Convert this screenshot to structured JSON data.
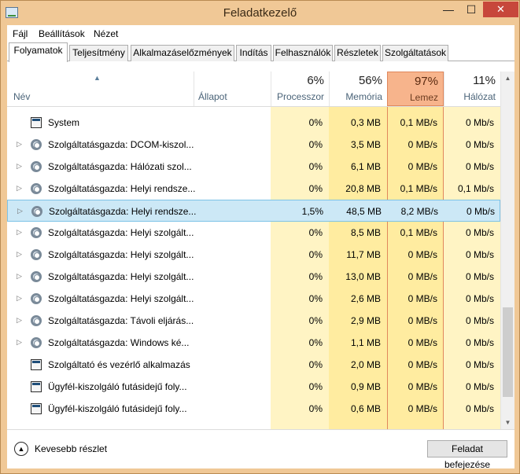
{
  "window": {
    "title": "Feladatkezelő",
    "min_glyph": "—",
    "max_glyph": "☐",
    "close_glyph": "✕"
  },
  "menu": [
    "Fájl",
    "Beállítások",
    "Nézet"
  ],
  "tabs": [
    "Folyamatok",
    "Teljesítmény",
    "Alkalmazáselőzmények",
    "Indítás",
    "Felhasználók",
    "Részletek",
    "Szolgáltatások"
  ],
  "active_tab": "Folyamatok",
  "columns": {
    "name": "Név",
    "status": "Állapot",
    "cpu": {
      "pct": "6%",
      "label": "Processzor"
    },
    "memory": {
      "pct": "56%",
      "label": "Memória"
    },
    "disk": {
      "pct": "97%",
      "label": "Lemez"
    },
    "network": {
      "pct": "11%",
      "label": "Hálózat"
    }
  },
  "rows": [
    {
      "icon": "window-icon",
      "expandable": false,
      "name": "System",
      "cpu": "0%",
      "mem": "0,3 MB",
      "disk": "0,1 MB/s",
      "net": "0 Mb/s"
    },
    {
      "icon": "gear-icon",
      "expandable": true,
      "name": "Szolgáltatásgazda: DCOM-kiszol...",
      "cpu": "0%",
      "mem": "3,5 MB",
      "disk": "0 MB/s",
      "net": "0 Mb/s"
    },
    {
      "icon": "gear-icon",
      "expandable": true,
      "name": "Szolgáltatásgazda: Hálózati szol...",
      "cpu": "0%",
      "mem": "6,1 MB",
      "disk": "0 MB/s",
      "net": "0 Mb/s"
    },
    {
      "icon": "gear-icon",
      "expandable": true,
      "name": "Szolgáltatásgazda: Helyi rendsze...",
      "cpu": "0%",
      "mem": "20,8 MB",
      "disk": "0,1 MB/s",
      "net": "0,1 Mb/s"
    },
    {
      "icon": "gear-icon",
      "expandable": true,
      "name": "Szolgáltatásgazda: Helyi rendsze...",
      "cpu": "1,5%",
      "mem": "48,5 MB",
      "disk": "8,2 MB/s",
      "net": "0 Mb/s",
      "selected": true
    },
    {
      "icon": "gear-icon",
      "expandable": true,
      "name": "Szolgáltatásgazda: Helyi szolgált...",
      "cpu": "0%",
      "mem": "8,5 MB",
      "disk": "0,1 MB/s",
      "net": "0 Mb/s"
    },
    {
      "icon": "gear-icon",
      "expandable": true,
      "name": "Szolgáltatásgazda: Helyi szolgált...",
      "cpu": "0%",
      "mem": "11,7 MB",
      "disk": "0 MB/s",
      "net": "0 Mb/s"
    },
    {
      "icon": "gear-icon",
      "expandable": true,
      "name": "Szolgáltatásgazda: Helyi szolgált...",
      "cpu": "0%",
      "mem": "13,0 MB",
      "disk": "0 MB/s",
      "net": "0 Mb/s"
    },
    {
      "icon": "gear-icon",
      "expandable": true,
      "name": "Szolgáltatásgazda: Helyi szolgált...",
      "cpu": "0%",
      "mem": "2,6 MB",
      "disk": "0 MB/s",
      "net": "0 Mb/s"
    },
    {
      "icon": "gear-icon",
      "expandable": true,
      "name": "Szolgáltatásgazda: Távoli eljárás...",
      "cpu": "0%",
      "mem": "2,9 MB",
      "disk": "0 MB/s",
      "net": "0 Mb/s"
    },
    {
      "icon": "gear-icon",
      "expandable": true,
      "name": "Szolgáltatásgazda: Windows ké...",
      "cpu": "0%",
      "mem": "1,1 MB",
      "disk": "0 MB/s",
      "net": "0 Mb/s"
    },
    {
      "icon": "window-icon",
      "expandable": false,
      "name": "Szolgáltató és vezérlő alkalmazás",
      "cpu": "0%",
      "mem": "2,0 MB",
      "disk": "0 MB/s",
      "net": "0 Mb/s"
    },
    {
      "icon": "window-icon",
      "expandable": false,
      "name": "Ügyfél-kiszolgáló futásidejű foly...",
      "cpu": "0%",
      "mem": "0,9 MB",
      "disk": "0 MB/s",
      "net": "0 Mb/s"
    },
    {
      "icon": "window-icon",
      "expandable": false,
      "name": "Ügyfél-kiszolgáló futásidejű foly...",
      "cpu": "0%",
      "mem": "0,6 MB",
      "disk": "0 MB/s",
      "net": "0 Mb/s"
    }
  ],
  "footer": {
    "fewer_details": "Kevesebb részlet",
    "end_task": "Feladat befejezése"
  },
  "colors": {
    "frame": "#f0c896",
    "close": "#c7473b",
    "cpu_bg": "#fff4c4",
    "mem_bg": "#ffeca0",
    "disk_bg": "#ffeca0",
    "disk_header": "#f7b48c",
    "selected": "#cce8f6"
  }
}
